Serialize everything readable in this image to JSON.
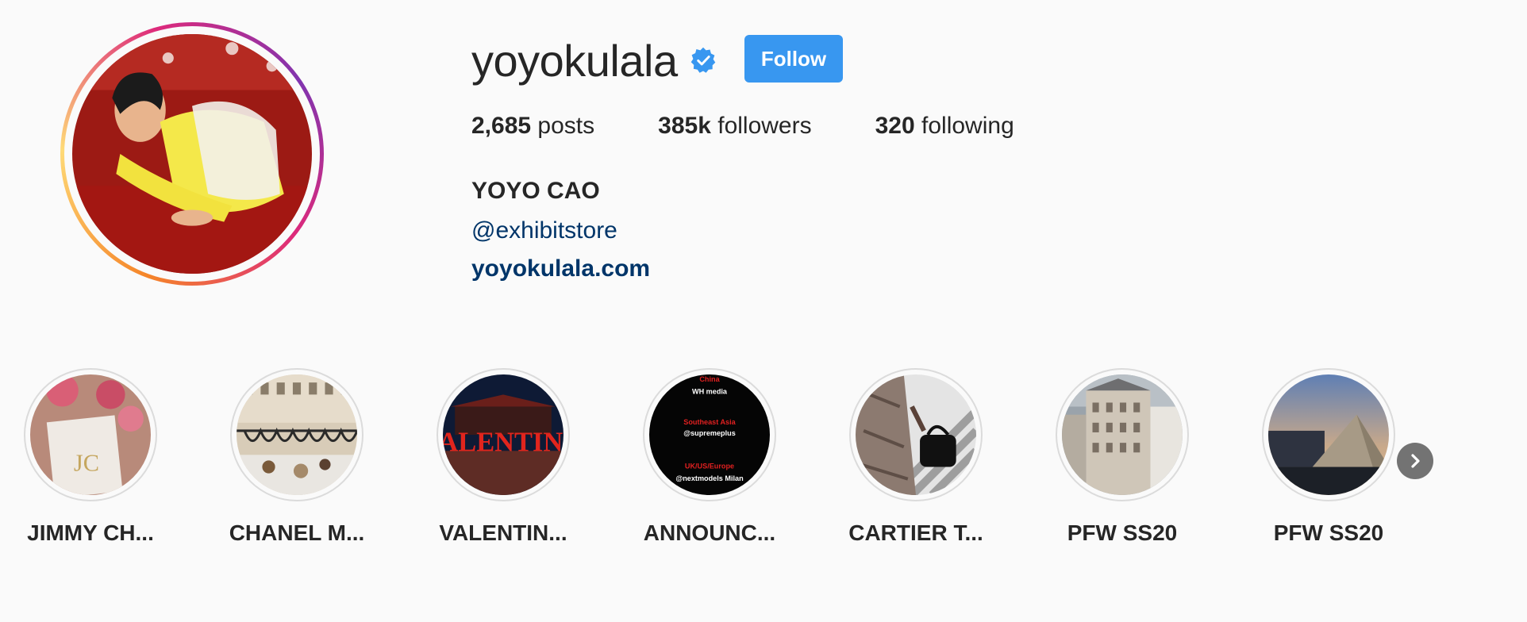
{
  "profile": {
    "username": "yoyokulala",
    "verified": true,
    "follow_label": "Follow",
    "posts_count": "2,685",
    "posts_label": "posts",
    "followers_count": "385k",
    "followers_label": "followers",
    "following_count": "320",
    "following_label": "following",
    "full_name": "YOYO CAO",
    "mention": "@exhibitstore",
    "website": "yoyokulala.com"
  },
  "highlights": [
    {
      "label": "JIMMY CH..."
    },
    {
      "label": "CHANEL M..."
    },
    {
      "label": "VALENTIN..."
    },
    {
      "label": "ANNOUNC...",
      "lines": [
        "China",
        "WH media",
        "Southeast Asia",
        "@supremeplus",
        "UK/US/Europe",
        "@nextmodels Milan"
      ],
      "valentino_text": ""
    },
    {
      "label": "CARTIER T..."
    },
    {
      "label": "PFW SS20"
    },
    {
      "label": "PFW SS20"
    }
  ],
  "valentino_sign": "VALENTINO",
  "colors": {
    "follow_button": "#3897f0",
    "link": "#003569",
    "verified_badge": "#3897f0"
  },
  "icons": {
    "verified": "verified-badge-icon",
    "next": "chevron-right-icon"
  }
}
